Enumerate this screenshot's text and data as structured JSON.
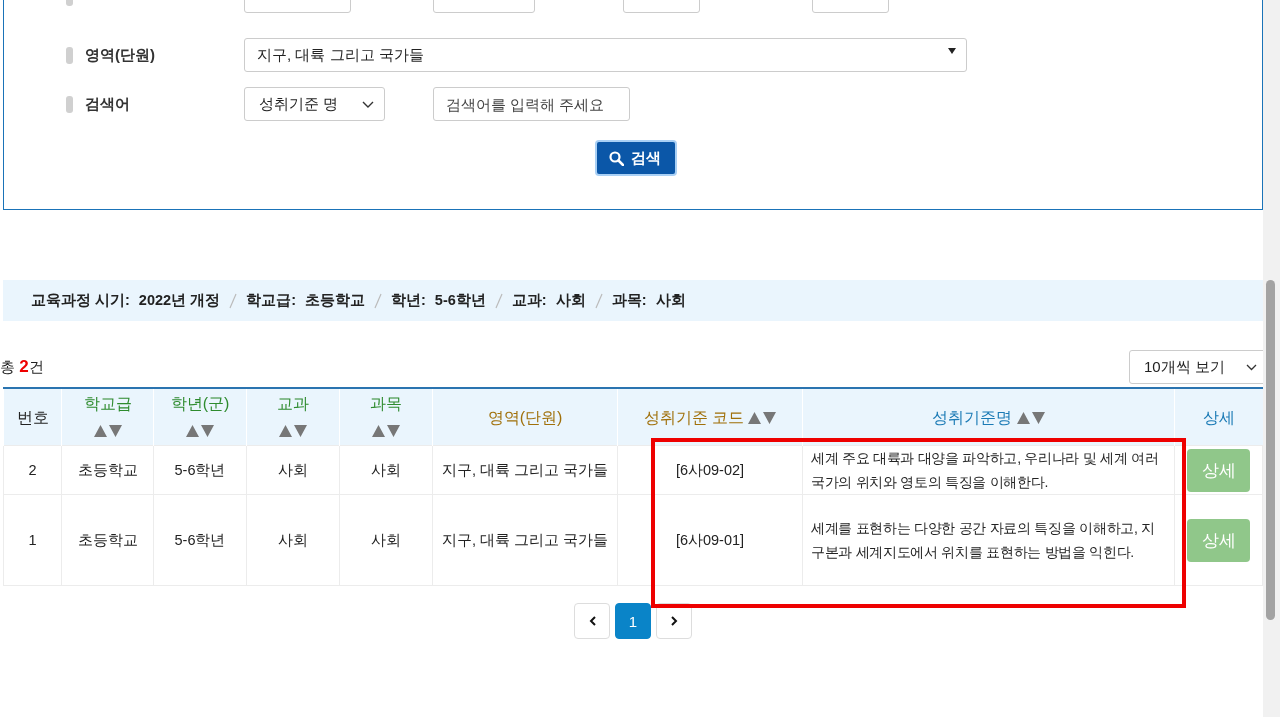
{
  "search_form": {
    "rows": [
      {
        "kind": "wide_select",
        "label": "영역(단원)",
        "value": "지구, 대륙 그리고 국가들"
      },
      {
        "kind": "select_and_input",
        "label": "검색어",
        "select_value": "성취기준 명",
        "placeholder": "검색어를 입력해 주세요"
      }
    ],
    "search_button": "검색"
  },
  "filter_summary": [
    {
      "label": "교육과정 시기:",
      "value": "2022년 개정"
    },
    {
      "label": "학교급:",
      "value": "초등학교"
    },
    {
      "label": "학년:",
      "value": "5-6학년"
    },
    {
      "label": "교과:",
      "value": "사회"
    },
    {
      "label": "과목:",
      "value": "사회"
    }
  ],
  "total": "총 **2**건",
  "page_size": "10개씩 보기",
  "table": {
    "columns": [
      {
        "label": "번호",
        "color": "#222222",
        "sortable": false
      },
      {
        "label": "학교급",
        "color": "#2e8b2e",
        "sortable": true
      },
      {
        "label": "학년(군)",
        "color": "#2e8b2e",
        "sortable": true
      },
      {
        "label": "교과",
        "color": "#2e8b2e",
        "sortable": true
      },
      {
        "label": "과목",
        "color": "#2e8b2e",
        "sortable": true
      },
      {
        "label": "영역(단원)",
        "color": "#a0700a",
        "sortable": false
      },
      {
        "label": "성취기준 코드",
        "color": "#a0700a",
        "sortable": true
      },
      {
        "label": "성취기준명",
        "color": "#1a7ab5",
        "sortable": true
      },
      {
        "label": "상세",
        "color": "#1a7ab5",
        "sortable": false
      }
    ],
    "rows": [
      {
        "cells": [
          "2",
          "초등학교",
          "5-6학년",
          "사회",
          "사회",
          "지구, 대륙 그리고 국가들",
          "[6사09-02]",
          "세계 주요 대륙과 대양을 파악하고, 우리나라 및 세계 여러 국가의 위치와 영토의 특징을 이해한다."
        ],
        "detail_button": "상세"
      },
      {
        "cells": [
          "1",
          "초등학교",
          "5-6학년",
          "사회",
          "사회",
          "지구, 대륙 그리고 국가들",
          "[6사09-01]",
          "세계를 표현하는 다양한 공간 자료의 특징을 이해하고, 지구본과 세계지도에서 위치를 표현하는 방법을 익힌다."
        ],
        "detail_button": "상세"
      }
    ]
  },
  "pagination": {
    "pages": [
      {
        "label": "1",
        "selected": true
      }
    ]
  }
}
